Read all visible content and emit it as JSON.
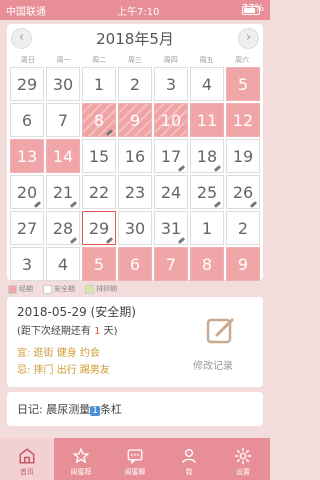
{
  "status": {
    "carrier": "中国联通",
    "time": "上午7:10",
    "battery": "77%",
    "battery_level": 0.77
  },
  "calendar": {
    "title": "2018年5月",
    "prev_icon": "chevron-left-icon",
    "next_icon": "chevron-right-icon",
    "weekdays": [
      "周日",
      "周一",
      "周二",
      "周三",
      "周四",
      "周五",
      "周六"
    ],
    "days": [
      {
        "d": "29",
        "t": "n"
      },
      {
        "d": "30",
        "t": "n"
      },
      {
        "d": "1",
        "t": "n"
      },
      {
        "d": "2",
        "t": "n"
      },
      {
        "d": "3",
        "t": "n"
      },
      {
        "d": "4",
        "t": "n"
      },
      {
        "d": "5",
        "t": "p"
      },
      {
        "d": "6",
        "t": "n"
      },
      {
        "d": "7",
        "t": "n"
      },
      {
        "d": "8",
        "t": "s",
        "m": true
      },
      {
        "d": "9",
        "t": "s"
      },
      {
        "d": "10",
        "t": "s"
      },
      {
        "d": "11",
        "t": "p"
      },
      {
        "d": "12",
        "t": "p"
      },
      {
        "d": "13",
        "t": "p"
      },
      {
        "d": "14",
        "t": "p"
      },
      {
        "d": "15",
        "t": "n"
      },
      {
        "d": "16",
        "t": "n"
      },
      {
        "d": "17",
        "t": "n",
        "m": true
      },
      {
        "d": "18",
        "t": "n",
        "m": true
      },
      {
        "d": "19",
        "t": "n"
      },
      {
        "d": "20",
        "t": "n",
        "m": true
      },
      {
        "d": "21",
        "t": "n",
        "m": true
      },
      {
        "d": "22",
        "t": "n"
      },
      {
        "d": "23",
        "t": "n"
      },
      {
        "d": "24",
        "t": "n"
      },
      {
        "d": "25",
        "t": "n",
        "m": true
      },
      {
        "d": "26",
        "t": "n",
        "m": true
      },
      {
        "d": "27",
        "t": "n"
      },
      {
        "d": "28",
        "t": "n",
        "m": true
      },
      {
        "d": "29",
        "t": "n",
        "m": true,
        "today": true
      },
      {
        "d": "30",
        "t": "n"
      },
      {
        "d": "31",
        "t": "n",
        "m": true
      },
      {
        "d": "1",
        "t": "n"
      },
      {
        "d": "2",
        "t": "n"
      },
      {
        "d": "3",
        "t": "n"
      },
      {
        "d": "4",
        "t": "n"
      },
      {
        "d": "5",
        "t": "p"
      },
      {
        "d": "6",
        "t": "p"
      },
      {
        "d": "7",
        "t": "p"
      },
      {
        "d": "8",
        "t": "p"
      },
      {
        "d": "9",
        "t": "p"
      }
    ]
  },
  "legend": [
    {
      "label": "经期",
      "color": "#f0a6a8"
    },
    {
      "label": "安全期",
      "color": "#ffffff"
    },
    {
      "label": "排卵期",
      "color": "#d9e8a8"
    }
  ],
  "info": {
    "date_line": "2018-05-29 (安全期)",
    "countdown_pre": "(距下次经期还有",
    "countdown_num": "1",
    "countdown_post": "天)",
    "yi": "宜: 逛街 健身 约会",
    "ji": "忌: 摔门 出行 踢男友",
    "edit_label": "修改记录"
  },
  "diary": {
    "prefix": "日记: 晨尿测量",
    "badge": "1",
    "suffix": "条杠"
  },
  "tabs": [
    {
      "label": "首页",
      "icon": "home-icon",
      "active": true
    },
    {
      "label": "闺蜜荐",
      "icon": "star-icon",
      "active": false
    },
    {
      "label": "闺蜜聊",
      "icon": "chat-icon",
      "active": false
    },
    {
      "label": "我",
      "icon": "user-icon",
      "active": false
    },
    {
      "label": "设置",
      "icon": "gear-icon",
      "active": false
    }
  ]
}
